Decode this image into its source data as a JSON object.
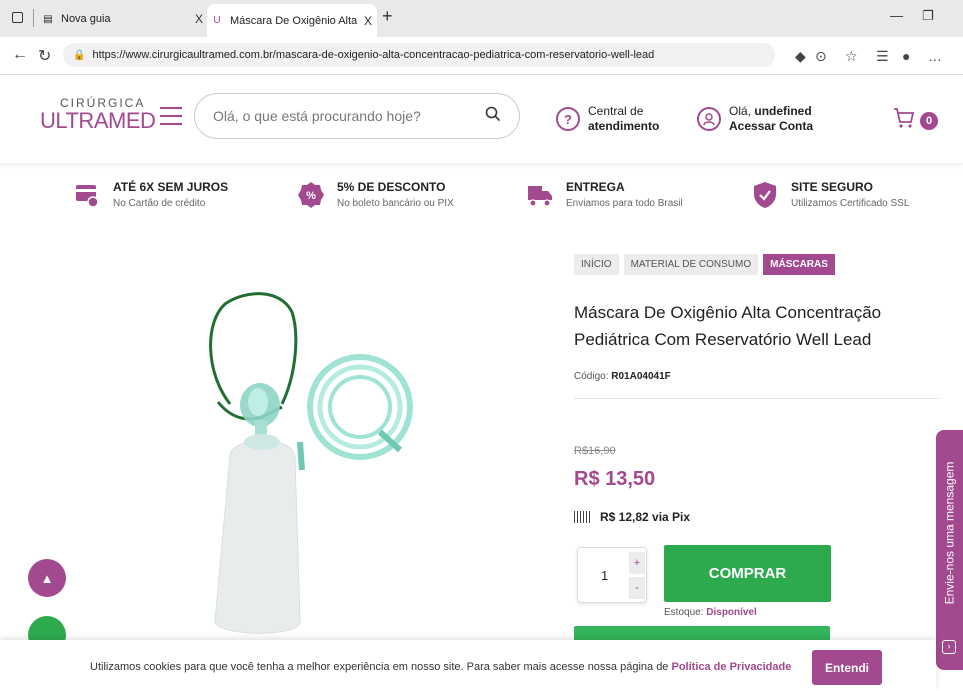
{
  "browser": {
    "tabs": [
      {
        "title": "Nova guia",
        "close": "X"
      },
      {
        "title": "Máscara De Oxigênio Alta Concen",
        "close": "X"
      }
    ],
    "new_tab": "+",
    "url": "https://www.cirurgicaultramed.com.br/mascara-de-oxigenio-alta-concentracao-pediatrica-com-reservatorio-well-lead"
  },
  "header": {
    "logo_top": "CIRÚRGICA",
    "logo_main": "ULTRAMED",
    "search_placeholder": "Olá, o que está procurando hoje?",
    "help_line1": "Central de",
    "help_line2": "atendimento",
    "account_greeting": "Olá,",
    "account_user": "undefined",
    "account_action": "Acessar Conta",
    "cart_count": "0"
  },
  "benefits": [
    {
      "title": "ATÉ 6X SEM JUROS",
      "subtitle": "No Cartão de crédito",
      "icon": "card-icon"
    },
    {
      "title": "5% DE DESCONTO",
      "subtitle": "No boleto bancário ou PIX",
      "icon": "percent-icon"
    },
    {
      "title": "ENTREGA",
      "subtitle": "Enviamos para todo Brasil",
      "icon": "truck-icon"
    },
    {
      "title": "SITE SEGURO",
      "subtitle": "Utilizamos Certificado SSL",
      "icon": "shield-icon"
    }
  ],
  "breadcrumb": [
    "INÍCIO",
    "MATERIAL DE CONSUMO",
    "MÁSCARAS"
  ],
  "product": {
    "title_line1": "Máscara De Oxigênio Alta Concentração",
    "title_line2": "Pediátrica Com Reservatório Well Lead",
    "code_label": "Código:",
    "code": "R01A04041F",
    "old_price": "R$16,90",
    "price": "R$ 13,50",
    "pix_price": "R$ 12,82 via Pix",
    "quantity": "1",
    "buy_label": "COMPRAR",
    "stock_label": "Estoque:",
    "stock_status": "Disponível"
  },
  "side_tab": "Envie-nos uma mensagem",
  "cookie": {
    "text": "Utilizamos cookies para que você tenha a melhor experiência em nosso site. Para saber mais acesse nossa página de",
    "link": "Política de Privacidade",
    "button": "Entendi"
  },
  "colors": {
    "brand": "#a3498f",
    "buy": "#2eaa4e"
  }
}
